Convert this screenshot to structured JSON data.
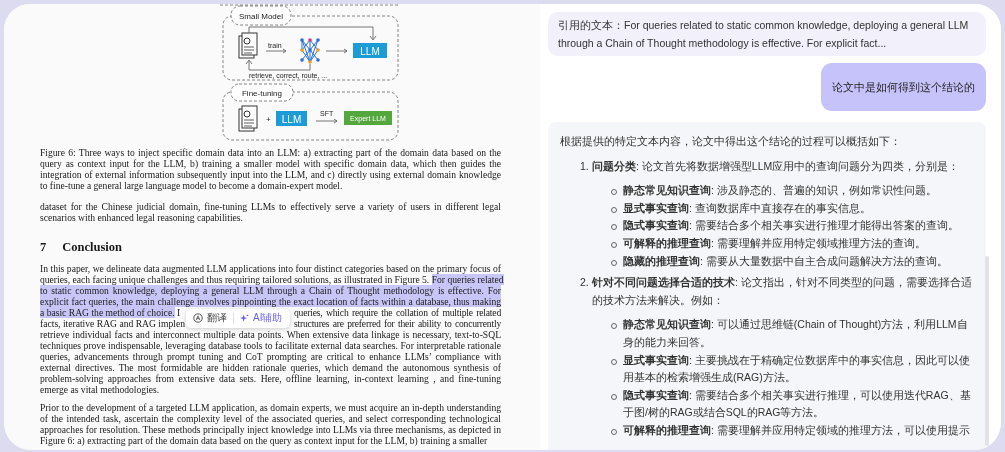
{
  "document": {
    "figure": {
      "small_model": {
        "label": "Small Model",
        "arrow_label": "train",
        "target": "LLM",
        "loop_label": "retrieve, correct, route, ..."
      },
      "fine_tuning": {
        "label": "Fine-tuning",
        "plus": "+",
        "model": "LLM",
        "arrow_label": "SFT",
        "result": "Expert LLM"
      }
    },
    "caption": "Figure 6: Three ways to inject specific domain data into an LLM: a) extracting part of the domain data based on the query as context input for the LLM, b) training a smaller model with specific domain data, which then guides the integration of external information subsequently input into the LLM, and c) directly using external domain knowledge to fine-tune a general large language model to become a domain-expert model.",
    "intro_paragraph": "dataset for the Chinese judicial domain, fine-tuning LLMs to effectively serve a variety of users in different legal scenarios with enhanced legal reasoning capabilities.",
    "section": {
      "number": "7",
      "title": "Conclusion"
    },
    "conclusion_paragraph": {
      "top": [
        [
          {
            "text": "In this paper, we delineate data augmented LLM applications into four distinct categories based on the primary focus of",
            "highlighted": false
          }
        ],
        [
          {
            "text": "queries, each facing unique challenges and thus requiring tailored solutions, as illustrated in Figure 5. ",
            "highlighted": false
          },
          {
            "text": "For queries related",
            "highlighted": true
          }
        ],
        [
          {
            "text": "to static common knowledge, deploying a general LLM through a Chain of Thought methodology is effective. For",
            "highlighted": true
          }
        ],
        [
          {
            "text": "explicit fact queries, the main challenge involves pinpointing the exact location of facts within a database, thus making",
            "highlighted": true
          }
        ]
      ],
      "left": [
        [
          {
            "text": "a basic RAG the method of choice.",
            "highlighted": true
          },
          {
            "text": " I",
            "highlighted": false
          }
        ],
        [
          {
            "text": "facts, iterative RAG and RAG implen",
            "highlighted": false
          }
        ]
      ],
      "right": [
        "queries, which require the collation of multiple related",
        "structures are preferred for their ability to concurrently"
      ],
      "bottom": "retrieve individual facts and interconnect multiple data points. When extensive data linkage is necessary, text-to-SQL techniques prove indispensable, leveraging database tools to facilitate external data searches. For interpretable rationale queries, advancements through prompt tuning and CoT prompting are critical to enhance LLMs’ compliance with external directives. The most formidable are hidden rationale queries, which demand the autonomous synthesis of problem-solving approaches from extensive data sets. Here, offline learning, in-context learning , and fine-tuning emerge as vital methodologies."
    },
    "selection_toolbar": {
      "buttons": [
        {
          "kind": "translate",
          "label": "翻译"
        },
        {
          "kind": "assist",
          "label": "AI辅助"
        }
      ]
    },
    "last_paragraph": "Prior to the development of a targeted LLM application, as domain experts, we must acquire an in-depth understanding of the intended task, ascertain the complexity level of the associated queries, and select corresponding technological approaches for resolution. These methods principally inject knowledge into LLMs via three mechanisms, as depicted in Figure 6: a) extracting part of the domain data based on the query as context input for the LLM, b) training a smaller"
  },
  "chat": {
    "quote": "引用的文本：For queries related to static common knowledge, deploying a general LLM through a Chain of Thought methodology is effective. For explicit fact...",
    "user_message": "论文中是如何得到这个结论的",
    "answer": {
      "intro": "根据提供的特定文本内容，论文中得出这个结论的过程可以概括如下：",
      "items": [
        {
          "number": "1.",
          "text": "**问题分类**: 论文首先将数据增强型LLM应用中的查询问题分为四类，分别是：",
          "children": [
            "**静态常见知识查询**: 涉及静态的、普遍的知识，例如常识性问题。",
            "**显式事实查询**: 查询数据库中直接存在的事实信息。",
            "**隐式事实查询**: 需要结合多个相关事实进行推理才能得出答案的查询。",
            "**可解释的推理查询**: 需要理解并应用特定领域推理方法的查询。",
            "**隐藏的推理查询**: 需要从大量数据中自主合成问题解决方法的查询。"
          ]
        },
        {
          "number": "2.",
          "text": "**针对不同问题选择合适的技术**: 论文指出，针对不同类型的问题，需要选择合适的技术方法来解决。例如：",
          "children": [
            "**静态常见知识查询**: 可以通过思维链(Chain of Thought)方法，利用LLM自身的能力来回答。",
            "**显式事实查询**: 主要挑战在于精确定位数据库中的事实信息，因此可以使用基本的检索增强生成(RAG)方法。",
            "**隐式事实查询**: 需要结合多个相关事实进行推理，可以使用迭代RAG、基于图/树的RAG或结合SQL的RAG等方法。",
            "**可解释的推理查询**: 需要理解并应用特定领域的推理方法，可以使用提示"
          ]
        }
      ]
    }
  }
}
